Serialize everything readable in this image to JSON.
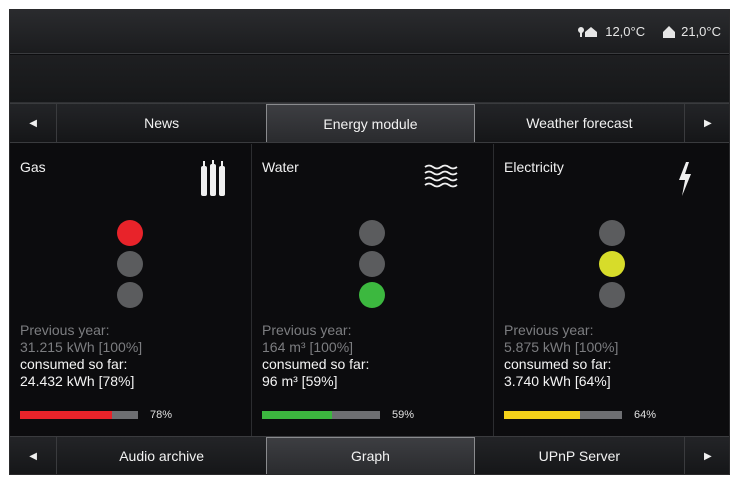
{
  "status": {
    "outdoor_temp": "12,0°C",
    "indoor_temp": "21,0°C"
  },
  "top_tabs": [
    "News",
    "Energy module",
    "Weather forecast"
  ],
  "bottom_tabs": [
    "Audio archive",
    "Graph",
    "UPnP Server"
  ],
  "arrows": {
    "left": "◀",
    "right": "▶"
  },
  "panels": [
    {
      "title": "Gas",
      "icon": "gas-bottles-icon",
      "lights": {
        "active": "red",
        "color": "#e8232a"
      },
      "prev_label": "Previous year:",
      "prev_value": "31.215 kWh [100%]",
      "cur_label": "consumed so far:",
      "cur_value": "24.432 kWh [78%]",
      "percent": 78,
      "percent_label": "78%",
      "bar_color": "#e8232a"
    },
    {
      "title": "Water",
      "icon": "water-waves-icon",
      "lights": {
        "active": "green",
        "color": "#3cb83f"
      },
      "prev_label": "Previous year:",
      "prev_value": "164 m³ [100%]",
      "cur_label": "consumed so far:",
      "cur_value": "96 m³ [59%]",
      "percent": 59,
      "percent_label": "59%",
      "bar_color": "#3cb83f"
    },
    {
      "title": "Electricity",
      "icon": "lightning-bolt-icon",
      "lights": {
        "active": "yellow",
        "color": "#d7dc2a"
      },
      "prev_label": "Previous year:",
      "prev_value": "5.875 kWh [100%]",
      "cur_label": "consumed so far:",
      "cur_value": "3.740 kWh [64%]",
      "percent": 64,
      "percent_label": "64%",
      "bar_color": "#f4d21a"
    }
  ]
}
